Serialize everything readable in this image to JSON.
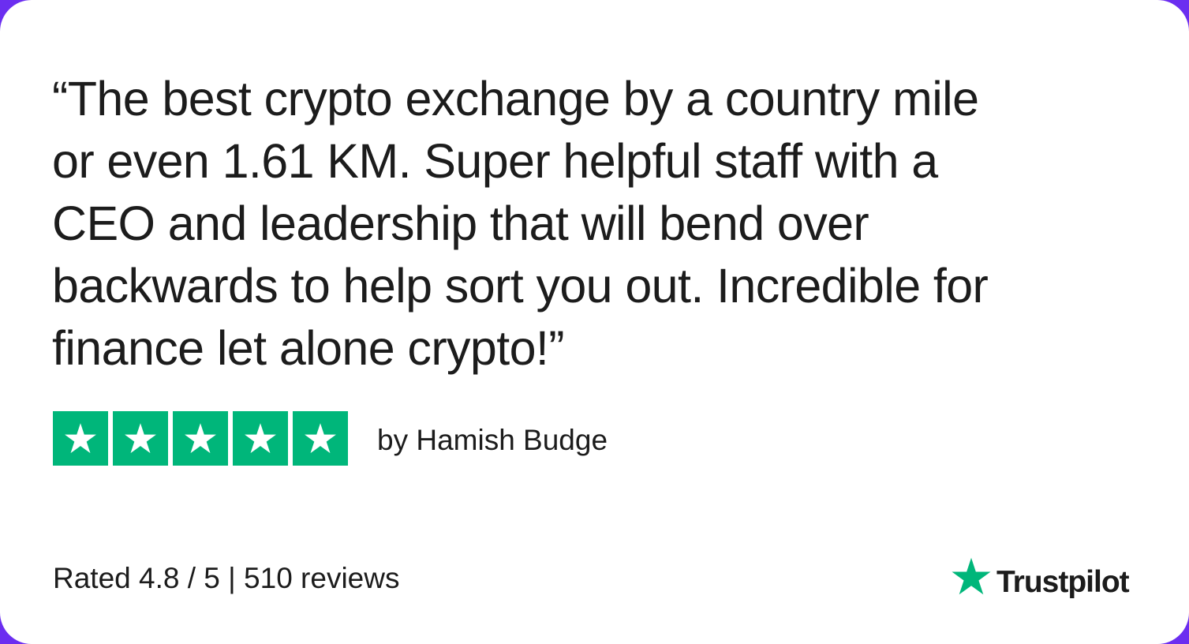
{
  "review": {
    "quote_lines": [
      "“The best crypto exchange by a country mile",
      "or even 1.61 KM. Super helpful staff with a",
      "CEO and leadership that will bend over",
      "backwards to help sort you out. Incredible for",
      "finance let alone crypto!”"
    ],
    "author": "by Hamish Budge",
    "stars": {
      "rating": 5,
      "max": 5
    }
  },
  "footer": {
    "rating_text": "Rated 4.8 / 5 | 510 reviews",
    "brand": "Trustpilot"
  },
  "colors": {
    "star_green": "#00b67a",
    "text": "#1c1c1c",
    "card_background": "#ffffff",
    "frame": "#6b2ef0"
  },
  "icons": {
    "star": "star-icon",
    "brand_logo": "trustpilot-star-icon"
  }
}
